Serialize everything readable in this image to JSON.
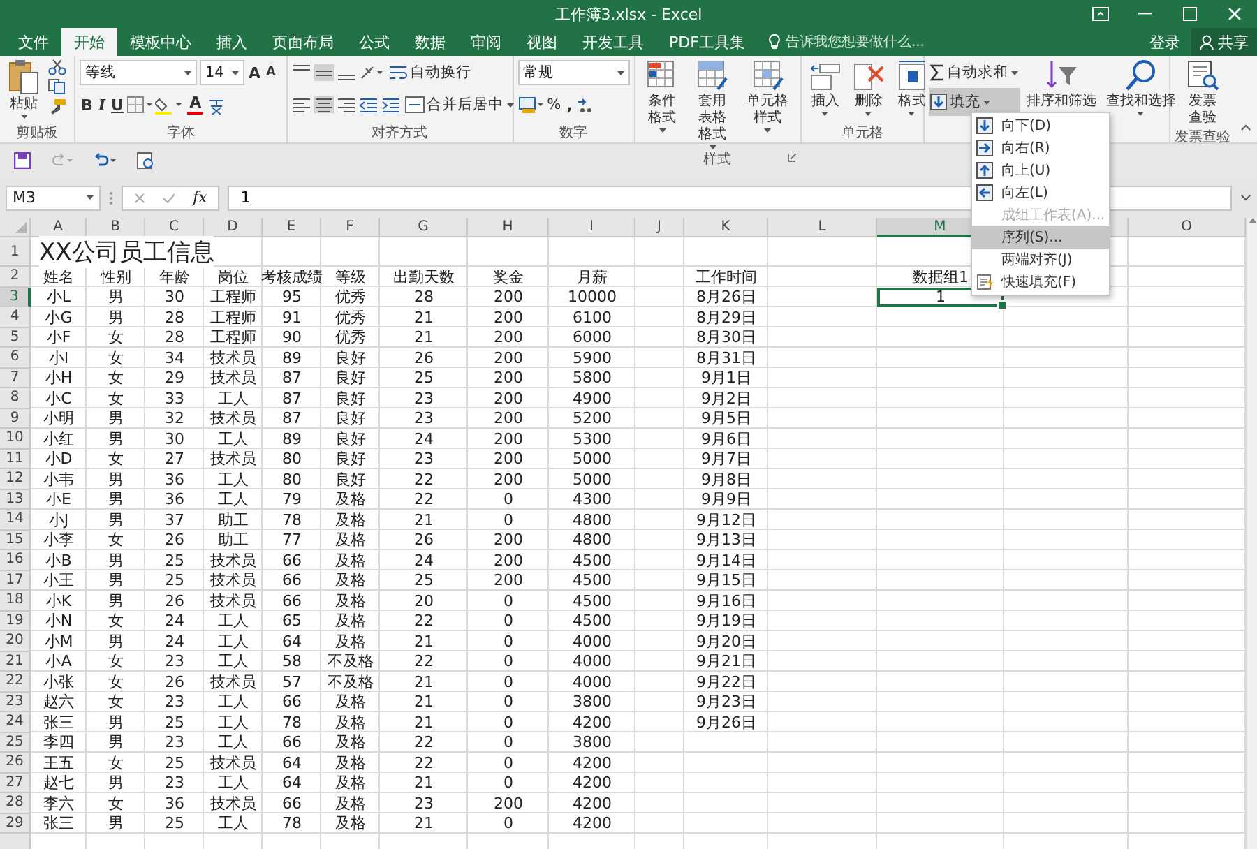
{
  "window": {
    "title": "工作簿3.xlsx - Excel"
  },
  "ribbon_tabs": [
    {
      "label": "文件",
      "selected": false
    },
    {
      "label": "开始",
      "selected": true
    },
    {
      "label": "模板中心",
      "selected": false
    },
    {
      "label": "插入",
      "selected": false
    },
    {
      "label": "页面布局",
      "selected": false
    },
    {
      "label": "公式",
      "selected": false
    },
    {
      "label": "数据",
      "selected": false
    },
    {
      "label": "审阅",
      "selected": false
    },
    {
      "label": "视图",
      "selected": false
    },
    {
      "label": "开发工具",
      "selected": false
    },
    {
      "label": "PDF工具集",
      "selected": false
    }
  ],
  "tell_me": {
    "placeholder": "告诉我您想要做什么..."
  },
  "account": {
    "sign_in": "登录",
    "share": "共享"
  },
  "ribbon": {
    "clipboard": {
      "label": "剪贴板",
      "paste": "粘贴"
    },
    "font": {
      "label": "字体",
      "font_name": "等线",
      "font_size": "14",
      "grow": "A",
      "shrink": "A",
      "bold": "B",
      "italic": "I",
      "underline": "U",
      "text_color_glyph": "A"
    },
    "alignment": {
      "label": "对齐方式",
      "wrap_text": "自动换行",
      "merge_center": "合并后居中"
    },
    "number": {
      "label": "数字",
      "format": "常规",
      "percent": "%",
      "comma": ","
    },
    "styles": {
      "label": "样式",
      "conditional": [
        "条件格式"
      ],
      "table_format": [
        "套用",
        "表格格式"
      ],
      "cell_styles": [
        "单元格样式"
      ]
    },
    "cells": {
      "label": "单元格",
      "insert": [
        "插入"
      ],
      "delete": [
        "删除"
      ],
      "format": [
        "格式"
      ]
    },
    "editing": {
      "autosum": "自动求和",
      "fill": "填充",
      "fill_expanded": true,
      "sort": "排序和筛选",
      "find": [
        "查找和选择"
      ]
    },
    "invoice": {
      "label": "发票查验",
      "check": [
        "发票",
        "查验"
      ]
    }
  },
  "fill_menu": [
    {
      "label": "向下(D)",
      "kind": "down",
      "disabled": false,
      "selected": false
    },
    {
      "label": "向右(R)",
      "kind": "right",
      "disabled": false,
      "selected": false
    },
    {
      "label": "向上(U)",
      "kind": "up",
      "disabled": false,
      "selected": false
    },
    {
      "label": "向左(L)",
      "kind": "left",
      "disabled": false,
      "selected": false
    },
    {
      "label": "成组工作表(A)...",
      "kind": "plain",
      "disabled": true,
      "selected": false
    },
    {
      "label": "序列(S)...",
      "kind": "plain",
      "disabled": false,
      "selected": true
    },
    {
      "label": "两端对齐(J)",
      "kind": "plain",
      "disabled": false,
      "selected": false
    },
    {
      "label": "快速填充(F)",
      "kind": "flash",
      "disabled": false,
      "selected": false
    }
  ],
  "formula_bar": {
    "name_box": "M3",
    "fx": "fx",
    "formula": "1"
  },
  "sheet": {
    "columns": [
      {
        "label": "A",
        "selected": false
      },
      {
        "label": "B",
        "selected": false
      },
      {
        "label": "C",
        "selected": false
      },
      {
        "label": "D",
        "selected": false
      },
      {
        "label": "E",
        "selected": false
      },
      {
        "label": "F",
        "selected": false
      },
      {
        "label": "G",
        "selected": false
      },
      {
        "label": "H",
        "selected": false
      },
      {
        "label": "I",
        "selected": false
      },
      {
        "label": "J",
        "selected": false
      },
      {
        "label": "K",
        "selected": false
      },
      {
        "label": "L",
        "selected": false
      },
      {
        "label": "M",
        "selected": true
      },
      {
        "selected": false
      },
      {
        "label": "O",
        "selected": false
      }
    ],
    "rows": [
      {
        "number": "1",
        "kind": "title",
        "selected": false,
        "cells": [
          "XX公司员工信息"
        ]
      },
      {
        "number": "2",
        "kind": "data",
        "selected": false,
        "cells": [
          "姓名",
          "性别",
          "年龄",
          "岗位",
          "考核成绩",
          "等级",
          "出勤天数",
          "奖金",
          "月薪",
          null,
          "工作时间",
          null,
          "数据组1"
        ]
      },
      {
        "number": "3",
        "kind": "data",
        "selected": true,
        "cells": [
          "小L",
          "男",
          "30",
          "工程师",
          "95",
          "优秀",
          "28",
          "200",
          "10000",
          null,
          "8月26日",
          null,
          "1"
        ]
      },
      {
        "number": "4",
        "kind": "data",
        "selected": false,
        "cells": [
          "小G",
          "男",
          "28",
          "工程师",
          "91",
          "优秀",
          "21",
          "200",
          "6100",
          null,
          "8月29日"
        ]
      },
      {
        "number": "5",
        "kind": "data",
        "selected": false,
        "cells": [
          "小F",
          "女",
          "28",
          "工程师",
          "90",
          "优秀",
          "21",
          "200",
          "6000",
          null,
          "8月30日"
        ]
      },
      {
        "number": "6",
        "kind": "data",
        "selected": false,
        "cells": [
          "小I",
          "女",
          "34",
          "技术员",
          "89",
          "良好",
          "26",
          "200",
          "5900",
          null,
          "8月31日"
        ]
      },
      {
        "number": "7",
        "kind": "data",
        "selected": false,
        "cells": [
          "小H",
          "女",
          "29",
          "技术员",
          "87",
          "良好",
          "25",
          "200",
          "5800",
          null,
          "9月1日"
        ]
      },
      {
        "number": "8",
        "kind": "data",
        "selected": false,
        "cells": [
          "小C",
          "女",
          "33",
          "工人",
          "87",
          "良好",
          "23",
          "200",
          "4900",
          null,
          "9月2日"
        ]
      },
      {
        "number": "9",
        "kind": "data",
        "selected": false,
        "cells": [
          "小明",
          "男",
          "32",
          "技术员",
          "87",
          "良好",
          "23",
          "200",
          "5200",
          null,
          "9月5日"
        ]
      },
      {
        "number": "10",
        "kind": "data",
        "selected": false,
        "cells": [
          "小红",
          "男",
          "30",
          "工人",
          "89",
          "良好",
          "24",
          "200",
          "5300",
          null,
          "9月6日"
        ]
      },
      {
        "number": "11",
        "kind": "data",
        "selected": false,
        "cells": [
          "小D",
          "女",
          "27",
          "技术员",
          "80",
          "良好",
          "23",
          "200",
          "5000",
          null,
          "9月7日"
        ]
      },
      {
        "number": "12",
        "kind": "data",
        "selected": false,
        "cells": [
          "小韦",
          "男",
          "36",
          "工人",
          "80",
          "良好",
          "22",
          "200",
          "5000",
          null,
          "9月8日"
        ]
      },
      {
        "number": "13",
        "kind": "data",
        "selected": false,
        "cells": [
          "小E",
          "男",
          "36",
          "工人",
          "79",
          "及格",
          "22",
          "0",
          "4300",
          null,
          "9月9日"
        ]
      },
      {
        "number": "14",
        "kind": "data",
        "selected": false,
        "cells": [
          "小J",
          "男",
          "37",
          "助工",
          "78",
          "及格",
          "21",
          "0",
          "4800",
          null,
          "9月12日"
        ]
      },
      {
        "number": "15",
        "kind": "data",
        "selected": false,
        "cells": [
          "小李",
          "女",
          "26",
          "助工",
          "77",
          "及格",
          "26",
          "200",
          "4800",
          null,
          "9月13日"
        ]
      },
      {
        "number": "16",
        "kind": "data",
        "selected": false,
        "cells": [
          "小B",
          "男",
          "25",
          "技术员",
          "66",
          "及格",
          "24",
          "200",
          "4500",
          null,
          "9月14日"
        ]
      },
      {
        "number": "17",
        "kind": "data",
        "selected": false,
        "cells": [
          "小王",
          "男",
          "25",
          "技术员",
          "66",
          "及格",
          "25",
          "200",
          "4500",
          null,
          "9月15日"
        ]
      },
      {
        "number": "18",
        "kind": "data",
        "selected": false,
        "cells": [
          "小K",
          "男",
          "26",
          "技术员",
          "66",
          "及格",
          "20",
          "0",
          "4500",
          null,
          "9月16日"
        ]
      },
      {
        "number": "19",
        "kind": "data",
        "selected": false,
        "cells": [
          "小N",
          "女",
          "24",
          "工人",
          "65",
          "及格",
          "22",
          "0",
          "4500",
          null,
          "9月19日"
        ]
      },
      {
        "number": "20",
        "kind": "data",
        "selected": false,
        "cells": [
          "小M",
          "男",
          "24",
          "工人",
          "64",
          "及格",
          "21",
          "0",
          "4000",
          null,
          "9月20日"
        ]
      },
      {
        "number": "21",
        "kind": "data",
        "selected": false,
        "cells": [
          "小A",
          "女",
          "23",
          "工人",
          "58",
          "不及格",
          "22",
          "0",
          "4000",
          null,
          "9月21日"
        ]
      },
      {
        "number": "22",
        "kind": "data",
        "selected": false,
        "cells": [
          "小张",
          "女",
          "26",
          "技术员",
          "57",
          "不及格",
          "21",
          "0",
          "4000",
          null,
          "9月22日"
        ]
      },
      {
        "number": "23",
        "kind": "data",
        "selected": false,
        "cells": [
          "赵六",
          "女",
          "23",
          "工人",
          "66",
          "及格",
          "21",
          "0",
          "3800",
          null,
          "9月23日"
        ]
      },
      {
        "number": "24",
        "kind": "data",
        "selected": false,
        "cells": [
          "张三",
          "男",
          "25",
          "工人",
          "78",
          "及格",
          "21",
          "0",
          "4200",
          null,
          "9月26日"
        ]
      },
      {
        "number": "25",
        "kind": "data",
        "selected": false,
        "cells": [
          "李四",
          "男",
          "23",
          "工人",
          "66",
          "及格",
          "22",
          "0",
          "3800"
        ]
      },
      {
        "number": "26",
        "kind": "data",
        "selected": false,
        "cells": [
          "王五",
          "女",
          "25",
          "技术员",
          "64",
          "及格",
          "22",
          "0",
          "4200"
        ]
      },
      {
        "number": "27",
        "kind": "data",
        "selected": false,
        "cells": [
          "赵七",
          "男",
          "23",
          "工人",
          "64",
          "及格",
          "21",
          "0",
          "4200"
        ]
      },
      {
        "number": "28",
        "kind": "data",
        "selected": false,
        "cells": [
          "李六",
          "女",
          "36",
          "技术员",
          "66",
          "及格",
          "23",
          "200",
          "4200"
        ]
      },
      {
        "number": "29",
        "kind": "data",
        "selected": false,
        "cells": [
          "张三",
          "男",
          "25",
          "工人",
          "78",
          "及格",
          "21",
          "0",
          "4200"
        ]
      }
    ]
  }
}
